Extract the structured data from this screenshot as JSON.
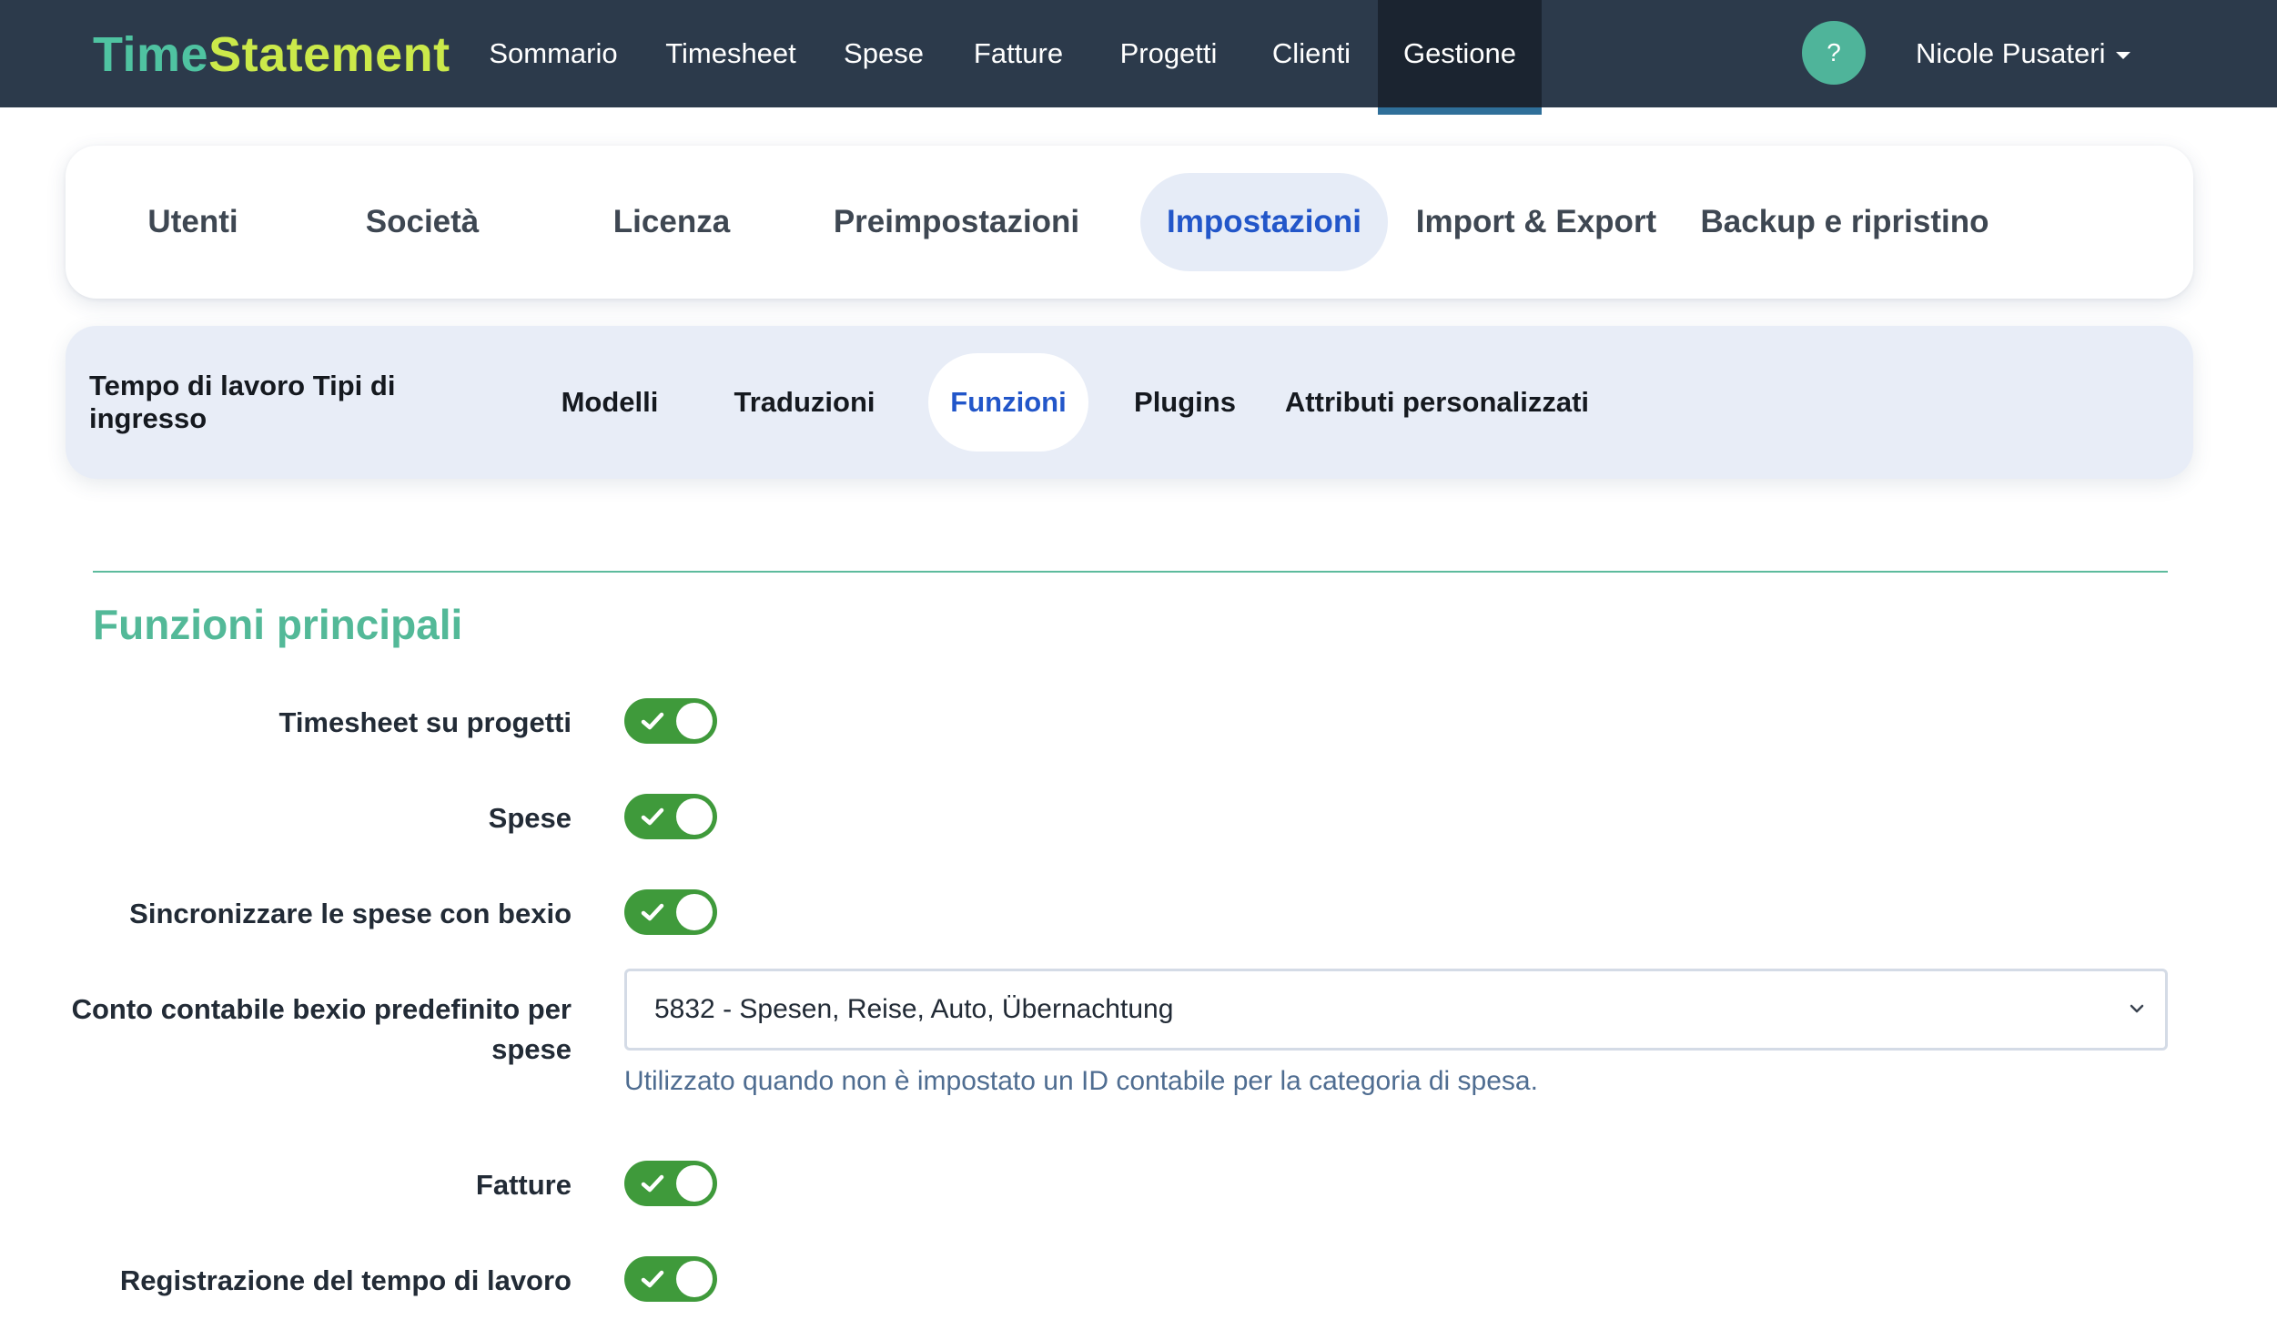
{
  "brand": {
    "part1": "Time",
    "part2": "Statement"
  },
  "nav": {
    "items": [
      {
        "label": "Sommario"
      },
      {
        "label": "Timesheet"
      },
      {
        "label": "Spese"
      },
      {
        "label": "Fatture"
      },
      {
        "label": "Progetti"
      },
      {
        "label": "Clienti"
      },
      {
        "label": "Gestione",
        "active": true
      }
    ],
    "help_label": "?",
    "user_name": "Nicole Pusateri"
  },
  "primary_tabs": [
    {
      "label": "Utenti"
    },
    {
      "label": "Società"
    },
    {
      "label": "Licenza"
    },
    {
      "label": "Preimpostazioni"
    },
    {
      "label": "Impostazioni",
      "active": true
    },
    {
      "label": "Import & Export"
    },
    {
      "label": "Backup e ripristino"
    }
  ],
  "secondary_tabs": [
    {
      "label": "Tempo di lavoro Tipi di ingresso"
    },
    {
      "label": "Modelli"
    },
    {
      "label": "Traduzioni"
    },
    {
      "label": "Funzioni",
      "active": true
    },
    {
      "label": "Plugins"
    },
    {
      "label": "Attributi personalizzati"
    }
  ],
  "section": {
    "title": "Funzioni principali",
    "settings": [
      {
        "label": "Timesheet su progetti",
        "enabled": true
      },
      {
        "label": "Spese",
        "enabled": true
      },
      {
        "label": "Sincronizzare le spese con bexio",
        "enabled": true
      },
      {
        "label_line1": "Conto contabile bexio predefinito per",
        "label_line2": "spese",
        "selected_value": "5832 - Spesen, Reise, Auto, Übernachtung",
        "help_text": "Utilizzato quando non è impostato un ID contabile per la categoria di spesa."
      },
      {
        "label": "Fatture",
        "enabled": true
      },
      {
        "label": "Registrazione del tempo di lavoro",
        "enabled": true
      }
    ]
  },
  "colors": {
    "nav_bg": "#2c3a4b",
    "brand_time": "#4fc3a1",
    "brand_statement": "#cbe94a",
    "accent_blue": "#2256c9",
    "section_green": "#53b998",
    "toggle_on": "#3f9a3b"
  }
}
